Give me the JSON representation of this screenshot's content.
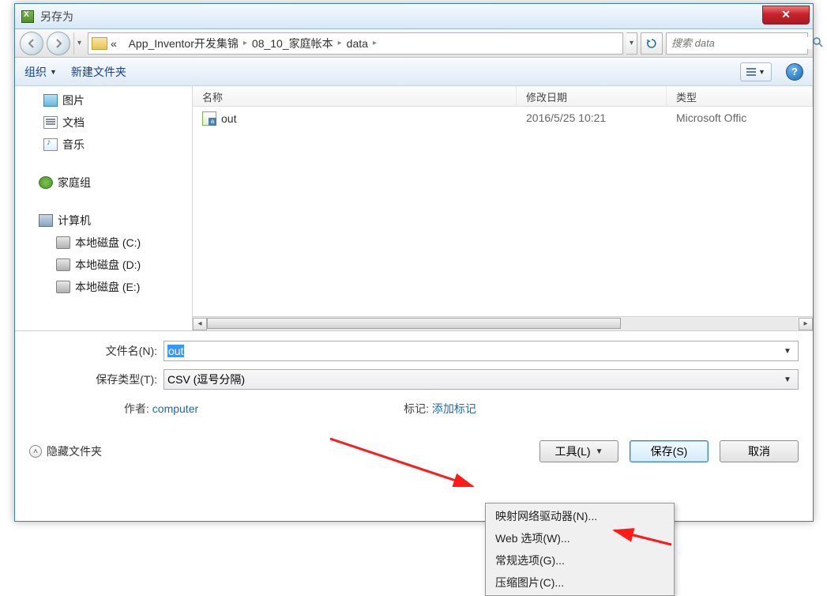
{
  "titlebar": {
    "title": "另存为"
  },
  "nav": {
    "crumb_prefix": "«",
    "crumbs": [
      "App_Inventor开发集锦",
      "08_10_家庭帐本",
      "data"
    ],
    "search_placeholder": "搜索 data"
  },
  "toolbar": {
    "organize": "组织",
    "new_folder": "新建文件夹",
    "help": "?"
  },
  "sidebar": {
    "items": [
      {
        "label": "图片",
        "icon": "pic"
      },
      {
        "label": "文档",
        "icon": "doc"
      },
      {
        "label": "音乐",
        "icon": "music"
      }
    ],
    "homegroup": "家庭组",
    "computer": "计算机",
    "drives": [
      "本地磁盘 (C:)",
      "本地磁盘 (D:)",
      "本地磁盘 (E:)"
    ]
  },
  "columns": {
    "name": "名称",
    "date": "修改日期",
    "type": "类型"
  },
  "files": [
    {
      "name": "out",
      "date": "2016/5/25 10:21",
      "type": "Microsoft Offic"
    }
  ],
  "form": {
    "filename_label": "文件名(N):",
    "filename_value": "out",
    "type_label": "保存类型(T):",
    "type_value": "CSV (逗号分隔)",
    "author_label": "作者:",
    "author_value": "computer",
    "tags_label": "标记:",
    "tags_value": "添加标记"
  },
  "buttons": {
    "hide_folders": "隐藏文件夹",
    "tools": "工具(L)",
    "save": "保存(S)",
    "cancel": "取消"
  },
  "tools_menu": [
    "映射网络驱动器(N)...",
    "Web 选项(W)...",
    "常规选项(G)...",
    "压缩图片(C)..."
  ]
}
